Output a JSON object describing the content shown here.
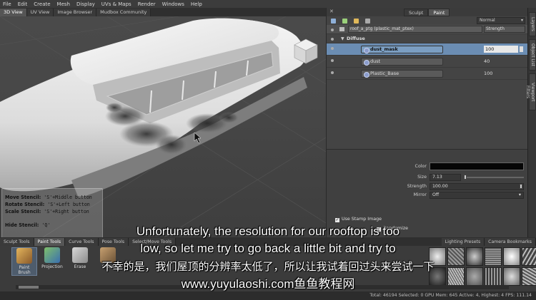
{
  "menu": [
    "File",
    "Edit",
    "Create",
    "Mesh",
    "Display",
    "UVs & Maps",
    "Render",
    "Windows",
    "Help"
  ],
  "view_tabs": [
    "3D View",
    "UV View",
    "Image Browser",
    "Mudbox Community"
  ],
  "stencil_help": {
    "move": [
      "Move Stencil:",
      " 'S'+Middle button"
    ],
    "rotate": [
      "Rotate Stencil:",
      " 'S'+Left button"
    ],
    "scale": [
      "Scale Stencil:",
      " 'S'+Right button"
    ],
    "hide": [
      "Hide Stencil:",
      " 'Q'"
    ]
  },
  "right_panel": {
    "tabs": [
      "Sculpt",
      "Paint"
    ],
    "blend_mode": "Normal",
    "paint_layer": "roof_a_ptg (plastic_mat_ptex)",
    "strength_header": "Strength",
    "group": "Diffuse",
    "channels": [
      {
        "name": "dust_mask",
        "value": "100"
      },
      {
        "name": "dust",
        "value": "40"
      },
      {
        "name": "Plastic_Base",
        "value": "100"
      }
    ],
    "properties": {
      "color_label": "Color",
      "size_label": "Size",
      "size_value": "7.13",
      "strength_label": "Strength",
      "strength_value": "100.00",
      "mirror_label": "Mirror",
      "mirror_value": "Off",
      "use_stamp": "Use Stamp Image",
      "randomize": "Randomize"
    },
    "colors": {
      "accent": "#6b8db3",
      "swatch": "#060606"
    }
  },
  "side_tabs": [
    "Layers",
    "Object List",
    "Viewport Filters"
  ],
  "tray_tabs": [
    "Sculpt Tools",
    "Paint Tools",
    "Curve Tools",
    "Pose Tools",
    "Select/Move Tools",
    "Lighting Presets",
    "Camera Bookmarks"
  ],
  "paint_tools": [
    "Paint Brush",
    "Projection",
    "Erase",
    "Clone"
  ],
  "status": "Total: 46194  Selected: 0  GPU Mem: 645  Active: 4, Highest: 4  FPS: 111.14",
  "subtitles": {
    "en_line1": "Unfortunately, the resolution for our rooftop is too",
    "en_line2": "low, so let me try to go back a little bit and try to",
    "cn_line": "不幸的是，我们屋顶的分辨率太低了，所以让我试着回过头来尝试一下",
    "website": "www.yuyulaoshi.com鱼鱼教程网"
  }
}
